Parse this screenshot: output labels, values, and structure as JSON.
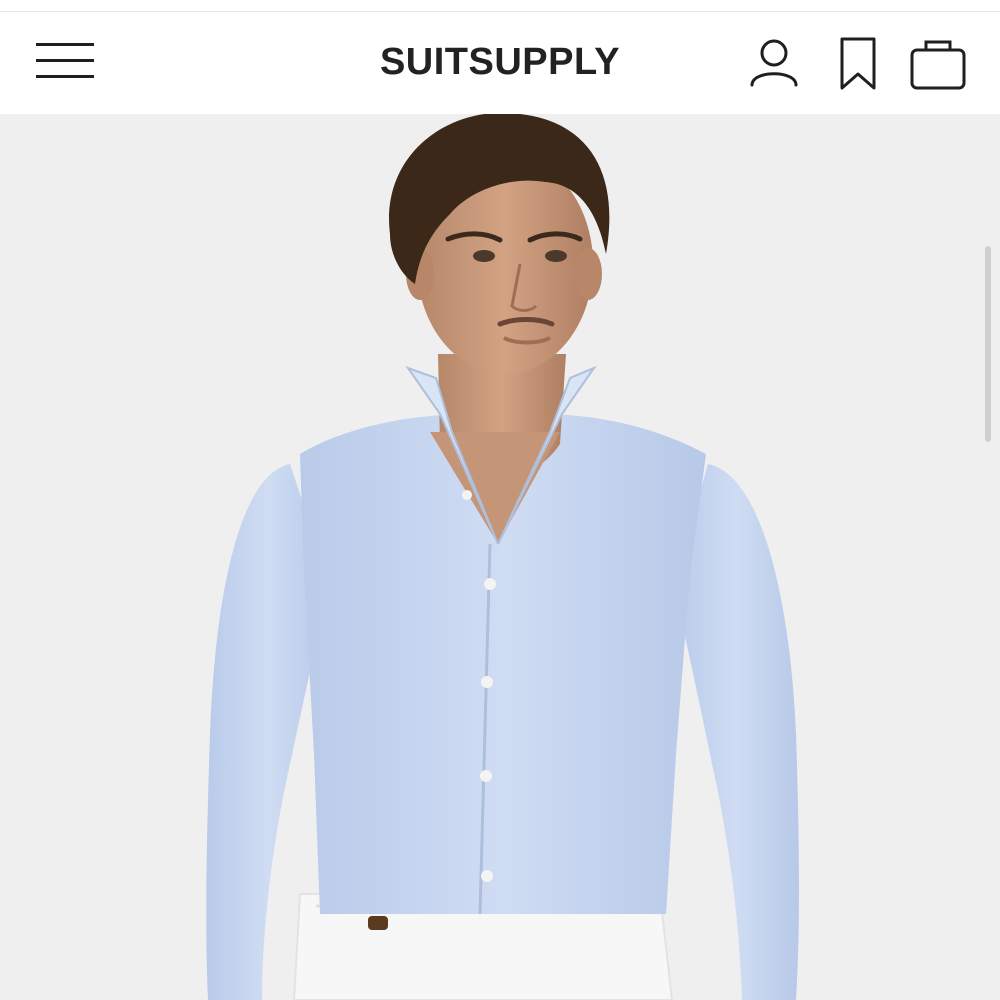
{
  "header": {
    "brand": "SUITSUPPLY"
  },
  "icons": {
    "menu": "hamburger-menu-icon",
    "account": "user-icon",
    "wishlist": "bookmark-icon",
    "cart": "shopping-bag-icon"
  },
  "colors": {
    "background": "#efeff0",
    "header": "#ffffff",
    "text": "#222222",
    "shirt": "#c6d6ef"
  }
}
